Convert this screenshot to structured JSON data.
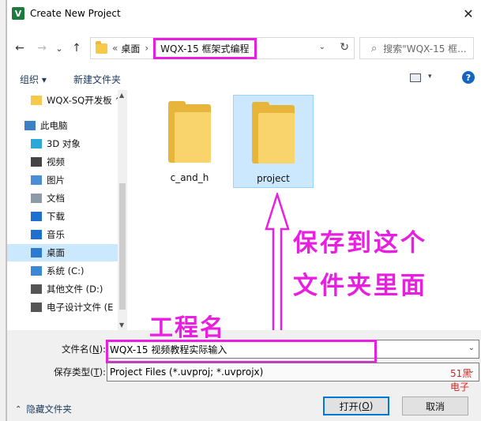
{
  "dialog": {
    "title": "Create New Project",
    "app_icon_letter": "V",
    "close_glyph": "✕"
  },
  "nav": {
    "back": "←",
    "forward": "→",
    "recent": "⌄",
    "up": "↑",
    "breadcrumb_overflow": "«",
    "breadcrumb_parent": "桌面",
    "breadcrumb_sep": "›",
    "breadcrumb_current": "WQX-15 框架式编程",
    "dropdown": "⌄",
    "refresh": "↻",
    "search_placeholder": "搜索\"WQX-15 框..."
  },
  "toolbar": {
    "organize": "组织 ▾",
    "new_folder": "新建文件夹",
    "view_arrow": "▾",
    "help": "?"
  },
  "sidebar": {
    "items": [
      {
        "label": "WQX-SQ开发板 ^",
        "icon": "folder-icon"
      },
      {
        "label": "此电脑",
        "icon": "pc-icon"
      },
      {
        "label": "3D 对象",
        "icon": "3d-objects-icon"
      },
      {
        "label": "视频",
        "icon": "video-icon"
      },
      {
        "label": "图片",
        "icon": "pictures-icon"
      },
      {
        "label": "文档",
        "icon": "documents-icon"
      },
      {
        "label": "下载",
        "icon": "download-icon"
      },
      {
        "label": "音乐",
        "icon": "music-icon"
      },
      {
        "label": "桌面",
        "icon": "desktop-icon"
      },
      {
        "label": "系统 (C:)",
        "icon": "drive-c-icon"
      },
      {
        "label": "其他文件 (D:)",
        "icon": "drive-icon"
      },
      {
        "label": "电子设计文件 (E",
        "icon": "drive-icon"
      }
    ],
    "selected_index": 8
  },
  "files": [
    {
      "name": "c_and_h",
      "selected": false
    },
    {
      "name": "project",
      "selected": true
    }
  ],
  "annotations": {
    "save_here_line1": "保存到这个",
    "save_here_line2": "文件夹里面",
    "project_name": "工程名"
  },
  "form": {
    "filename_label": "文件名(",
    "filename_key": "N",
    "filename_label_end": "):",
    "filename_value": "WQX-15 视频教程实际输入",
    "filetype_label": "保存类型(",
    "filetype_key": "T",
    "filetype_label_end": "):",
    "filetype_value": "Project Files (*.uvproj; *.uvprojx)",
    "watermark": "51黑电子",
    "dropdown": "⌄"
  },
  "footer": {
    "hide_folders_chevron": "⌃",
    "hide_folders": "隐藏文件夹",
    "open_label": "打开(",
    "open_key": "O",
    "open_end": ")",
    "cancel": "取消"
  },
  "colors": {
    "annotation": "#e81ee0",
    "selection": "#cce8ff",
    "accent": "#0078d7",
    "watermark": "#e0201f"
  }
}
